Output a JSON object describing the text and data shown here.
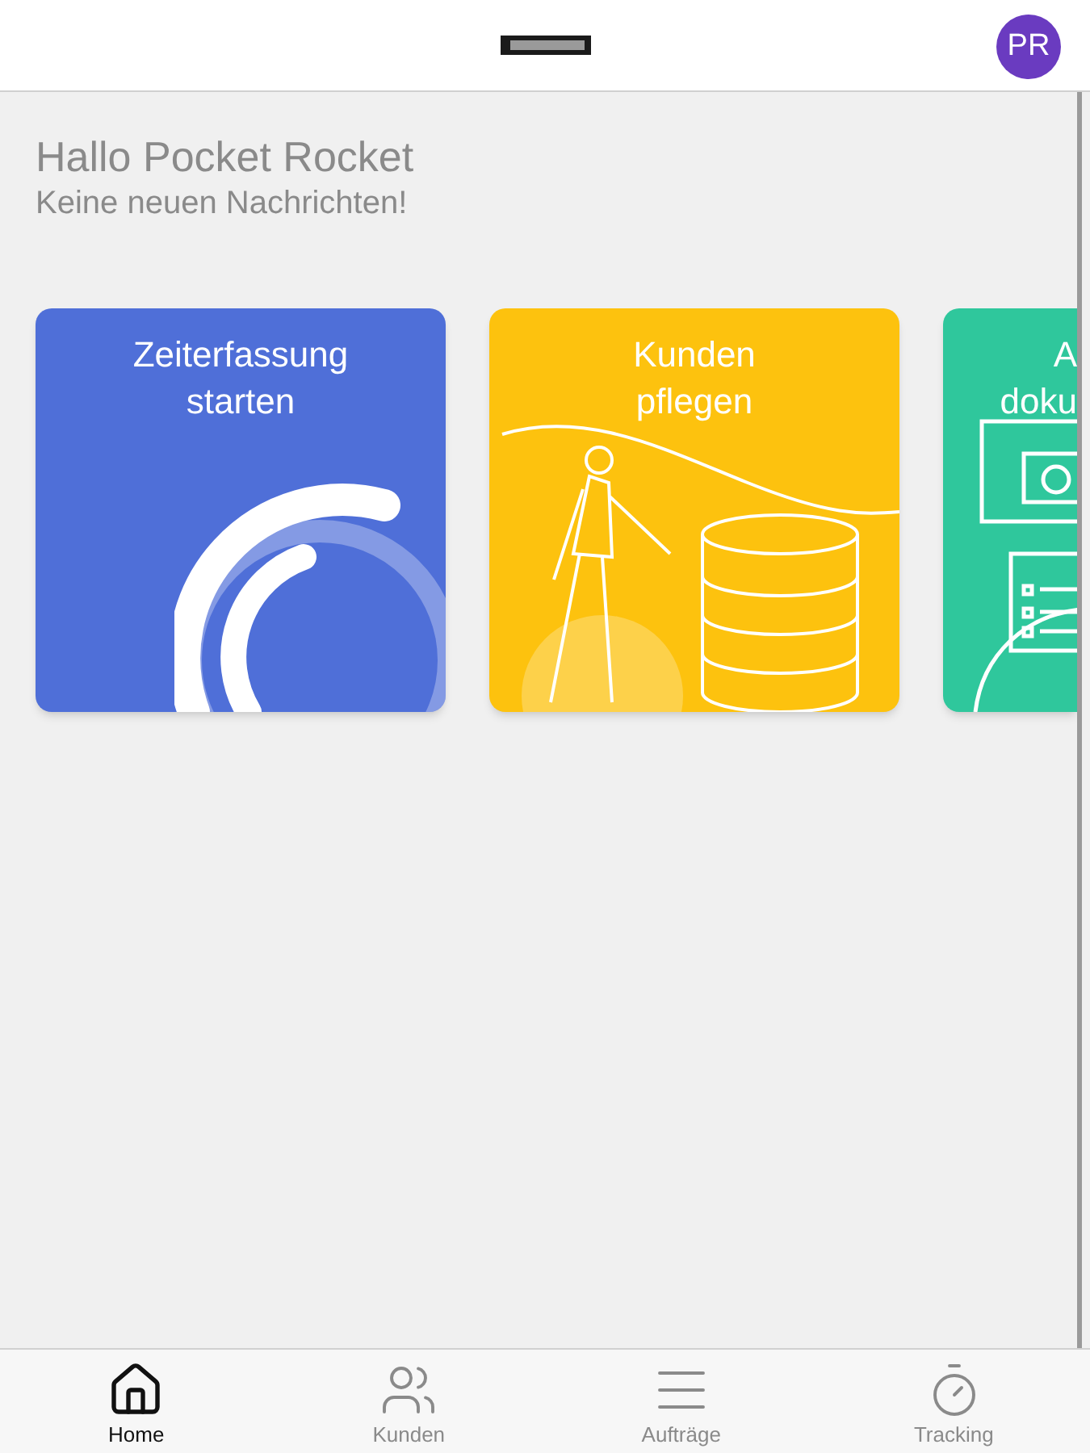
{
  "header": {
    "avatar": "PR"
  },
  "greeting": {
    "title": "Hallo Pocket Rocket",
    "subtitle": "Keine neuen Nachrichten!"
  },
  "cards": [
    {
      "kind": "timer",
      "color": "#4f6fd8",
      "title": [
        "Zeiterfassung",
        "starten"
      ]
    },
    {
      "kind": "customers",
      "color": "#fdc20e",
      "title": [
        "Kunden",
        "pflegen"
      ]
    },
    {
      "kind": "documents",
      "color": "#2fc79c",
      "title": [
        "A",
        "doku"
      ]
    }
  ],
  "nav": [
    {
      "kind": "home",
      "label": "Home",
      "selected": true
    },
    {
      "kind": "customers",
      "label": "Kunden",
      "selected": false
    },
    {
      "kind": "orders",
      "label": "Aufträge",
      "selected": false
    },
    {
      "kind": "tracking",
      "label": "Tracking",
      "selected": false
    }
  ]
}
